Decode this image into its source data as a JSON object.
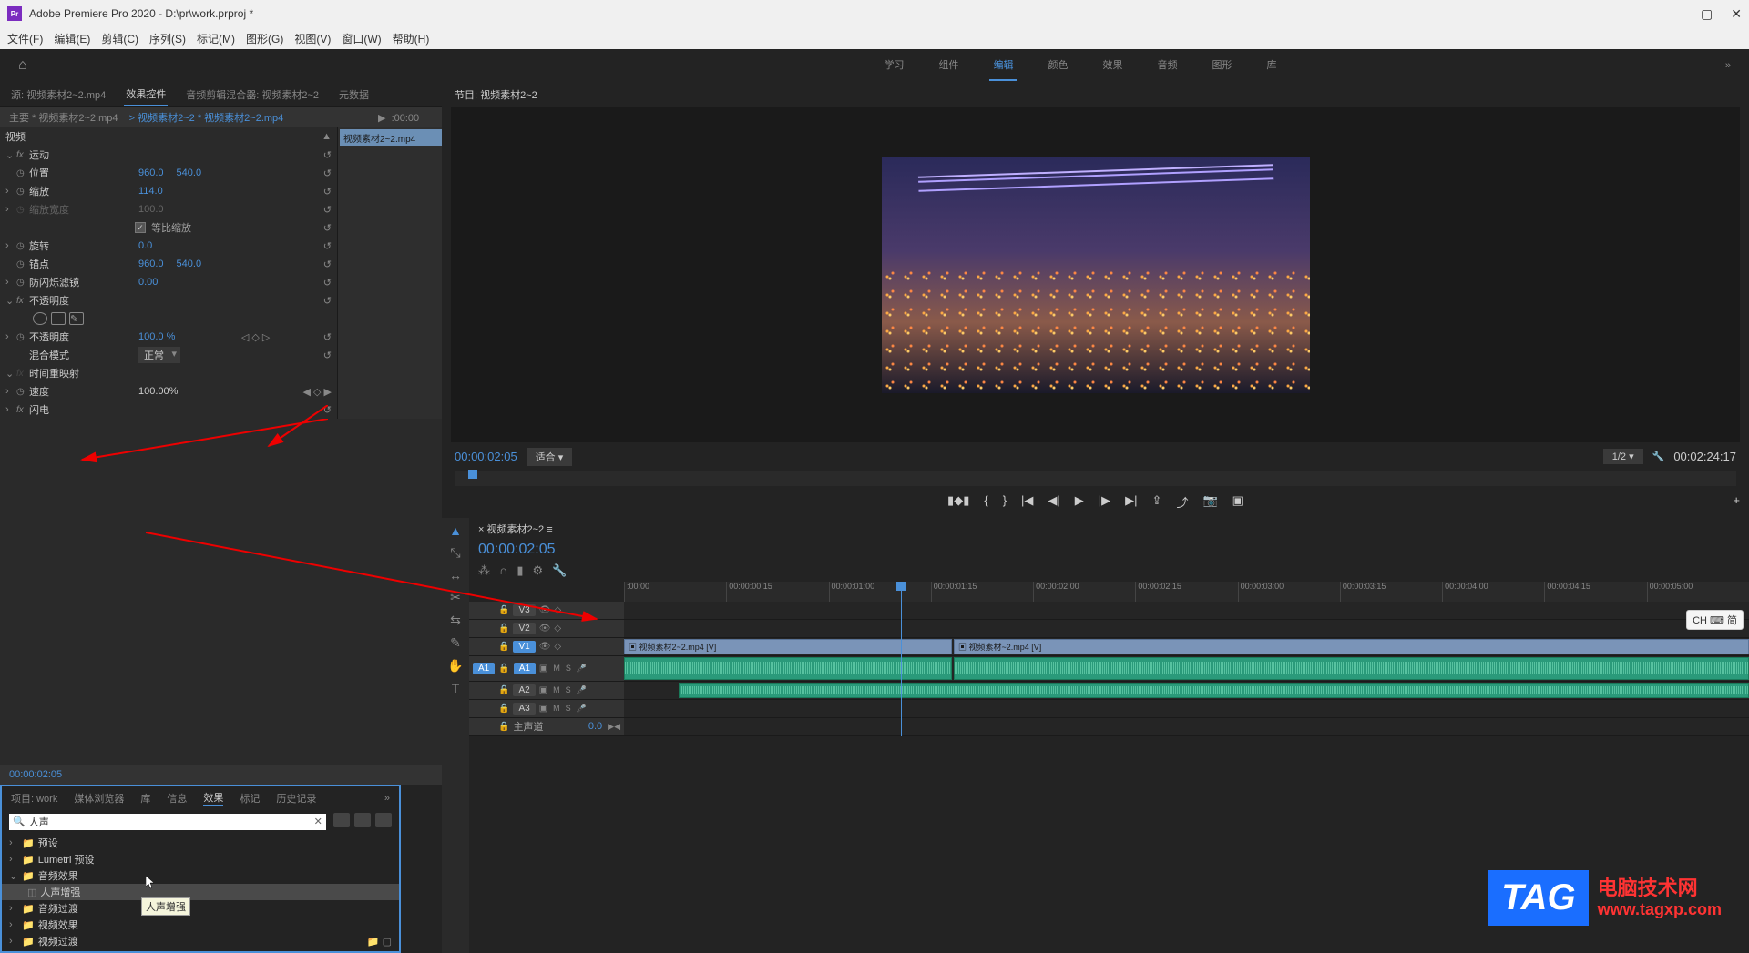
{
  "titlebar": {
    "app": "Adobe Premiere Pro 2020",
    "project": "D:\\pr\\work.prproj *",
    "icon_text": "Pr"
  },
  "menubar": [
    "文件(F)",
    "编辑(E)",
    "剪辑(C)",
    "序列(S)",
    "标记(M)",
    "图形(G)",
    "视图(V)",
    "窗口(W)",
    "帮助(H)"
  ],
  "workspaces": {
    "items": [
      "学习",
      "组件",
      "编辑",
      "颜色",
      "效果",
      "音频",
      "图形",
      "库"
    ],
    "active_index": 2
  },
  "source_tabs": {
    "items": [
      "源: 视频素材2~2.mp4",
      "效果控件",
      "音频剪辑混合器: 视频素材2~2",
      "元数据"
    ],
    "active_index": 1
  },
  "effect_controls": {
    "master_label": "主要 * 视频素材2~2.mp4",
    "clip_label": "视频素材2~2 * 视频素材2~2.mp4",
    "header_time": ":00:00",
    "clip_bar": "视频素材2~2.mp4",
    "video_label": "视频",
    "motion": {
      "label": "运动",
      "position": {
        "label": "位置",
        "x": "960.0",
        "y": "540.0"
      },
      "scale": {
        "label": "缩放",
        "value": "114.0"
      },
      "scale_width": {
        "label": "缩放宽度",
        "value": "100.0"
      },
      "uniform": {
        "label": "等比缩放",
        "checked": true
      },
      "rotation": {
        "label": "旋转",
        "value": "0.0"
      },
      "anchor": {
        "label": "锚点",
        "x": "960.0",
        "y": "540.0"
      },
      "antiflicker": {
        "label": "防闪烁滤镜",
        "value": "0.00"
      }
    },
    "opacity": {
      "label": "不透明度",
      "value_label": "不透明度",
      "value": "100.0 %",
      "blend_label": "混合模式",
      "blend_value": "正常"
    },
    "time_remap": {
      "label": "时间重映射",
      "speed_label": "速度",
      "speed_value": "100.00%"
    },
    "lightning": {
      "label": "闪电"
    },
    "footer_tc": "00:00:02:05"
  },
  "project_tabs": {
    "items": [
      "项目: work",
      "媒体浏览器",
      "库",
      "信息",
      "效果",
      "标记",
      "历史记录"
    ],
    "active_index": 4
  },
  "effects_panel": {
    "search_value": "人声",
    "tree": [
      {
        "name": "预设",
        "expanded": false
      },
      {
        "name": "Lumetri 预设",
        "expanded": false
      },
      {
        "name": "音频效果",
        "expanded": true,
        "children": [
          {
            "name": "人声增强",
            "selected": true
          }
        ]
      },
      {
        "name": "音频过渡",
        "expanded": false
      },
      {
        "name": "视频效果",
        "expanded": false
      },
      {
        "name": "视频过渡",
        "expanded": false
      }
    ],
    "tooltip": "人声增强"
  },
  "program": {
    "title": "节目: 视频素材2~2",
    "tc": "00:00:02:05",
    "fit": "适合",
    "zoom": "1/2",
    "duration": "00:02:24:17"
  },
  "timeline": {
    "sequence": "视频素材2~2",
    "tc": "00:00:02:05",
    "ruler": [
      ":00:00",
      "00:00:00:15",
      "00:00:01:00",
      "00:00:01:15",
      "00:00:02:00",
      "00:00:02:15",
      "00:00:03:00",
      "00:00:03:15",
      "00:00:04:00",
      "00:00:04:15",
      "00:00:05:00"
    ],
    "tracks": {
      "v3": "V3",
      "v2": "V2",
      "v1": "V1",
      "a1": "A1",
      "a2": "A2",
      "a3": "A3",
      "a1_src": "A1",
      "master": "主声道",
      "master_val": "0.0"
    },
    "clips": {
      "v1a": "视频素材2~2.mp4 [V]",
      "v1b": "视频素材~2.mp4 [V]"
    }
  },
  "watermark": {
    "tag": "TAG",
    "line1": "电脑技术网",
    "line2": "www.tagxp.com"
  },
  "ime": "CH ⌨ 简"
}
